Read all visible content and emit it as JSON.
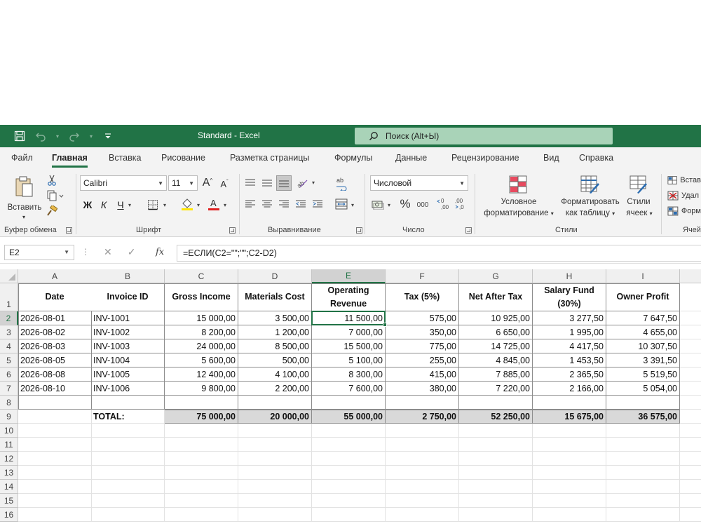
{
  "window": {
    "title": "Standard  -  Excel",
    "search_placeholder": "Поиск (Alt+Ы)"
  },
  "menu": {
    "tabs": [
      "Файл",
      "Главная",
      "Вставка",
      "Рисование",
      "Разметка страницы",
      "Формулы",
      "Данные",
      "Рецензирование",
      "Вид",
      "Справка"
    ],
    "active": "Главная"
  },
  "ribbon": {
    "clipboard": {
      "paste_label": "Вставить",
      "group_label": "Буфер обмена"
    },
    "font": {
      "name": "Calibri",
      "size": "11",
      "bold": "Ж",
      "italic": "К",
      "underline": "Ч",
      "group_label": "Шрифт"
    },
    "alignment": {
      "group_label": "Выравнивание"
    },
    "number": {
      "format": "Числовой",
      "group_label": "Число",
      "percent": "%",
      "thousands": "000"
    },
    "styles": {
      "conditional_line1": "Условное",
      "conditional_line2": "форматирование",
      "format_table_line1": "Форматировать",
      "format_table_line2": "как таблицу",
      "cell_styles_line1": "Стили",
      "cell_styles_line2": "ячеек",
      "group_label": "Стили"
    },
    "cells": {
      "insert": "Встав",
      "delete": "Удал",
      "format": "Форм",
      "group_label": "Ячей"
    }
  },
  "formula_bar": {
    "name_box": "E2",
    "fx": "fx",
    "formula": "=ЕСЛИ(C2=\"\";\"\";C2-D2)"
  },
  "sheet": {
    "columns": [
      "A",
      "B",
      "C",
      "D",
      "E",
      "F",
      "G",
      "H",
      "I"
    ],
    "selected_column": "E",
    "selected_row": 2,
    "row_numbers": [
      "1",
      "2",
      "3",
      "4",
      "5",
      "6",
      "7",
      "8",
      "9",
      "10",
      "11",
      "12",
      "13",
      "14",
      "15",
      "16"
    ],
    "headers": [
      "Date",
      "Invoice ID",
      "Gross Income",
      "Materials Cost",
      "Operating Revenue",
      "Tax (5%)",
      "Net After Tax",
      "Salary Fund (30%)",
      "Owner Profit"
    ],
    "rows": [
      [
        "2026-08-01",
        "INV-1001",
        "15 000,00",
        "3 500,00",
        "11 500,00",
        "575,00",
        "10 925,00",
        "3 277,50",
        "7 647,50"
      ],
      [
        "2026-08-02",
        "INV-1002",
        "8 200,00",
        "1 200,00",
        "7 000,00",
        "350,00",
        "6 650,00",
        "1 995,00",
        "4 655,00"
      ],
      [
        "2026-08-03",
        "INV-1003",
        "24 000,00",
        "8 500,00",
        "15 500,00",
        "775,00",
        "14 725,00",
        "4 417,50",
        "10 307,50"
      ],
      [
        "2026-08-05",
        "INV-1004",
        "5 600,00",
        "500,00",
        "5 100,00",
        "255,00",
        "4 845,00",
        "1 453,50",
        "3 391,50"
      ],
      [
        "2026-08-08",
        "INV-1005",
        "12 400,00",
        "4 100,00",
        "8 300,00",
        "415,00",
        "7 885,00",
        "2 365,50",
        "5 519,50"
      ],
      [
        "2026-08-10",
        "INV-1006",
        "9 800,00",
        "2 200,00",
        "7 600,00",
        "380,00",
        "7 220,00",
        "2 166,00",
        "5 054,00"
      ]
    ],
    "totals_label": "TOTAL:",
    "totals": [
      "75 000,00",
      "20 000,00",
      "55 000,00",
      "2 750,00",
      "52 250,00",
      "15 675,00",
      "36 575,00"
    ]
  },
  "colors": {
    "brand": "#217346",
    "search_bg": "#a9d3b8",
    "ribbon_bg": "#f3f3f3",
    "total_fill": "#d9d9d9"
  }
}
